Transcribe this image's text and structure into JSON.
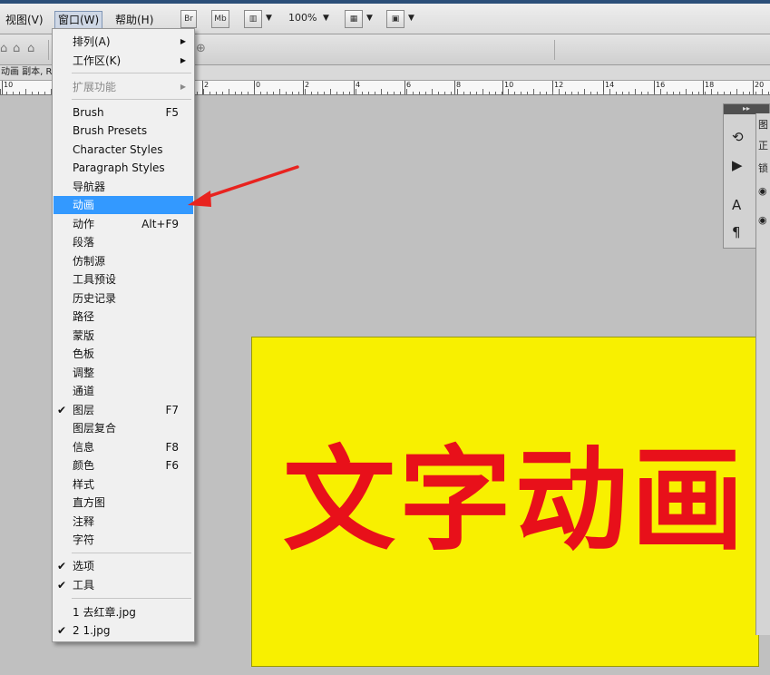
{
  "menubar": {
    "items": [
      "视图(V)",
      "窗口(W)",
      "帮助(H)"
    ],
    "br_label": "Br",
    "mb_label": "Mb",
    "zoom": "100%"
  },
  "tab": {
    "title": "动画 副本, R"
  },
  "ruler": {
    "labels": [
      "10",
      "2",
      "0",
      "2",
      "4",
      "6",
      "8",
      "10",
      "12",
      "14",
      "16",
      "18",
      "20"
    ]
  },
  "window_menu": {
    "arrange": "排列(A)",
    "workspace": "工作区(K)",
    "extensions": "扩展功能",
    "brush": "Brush",
    "brush_sc": "F5",
    "brush_presets": "Brush Presets",
    "char_styles": "Character Styles",
    "para_styles": "Paragraph Styles",
    "navigator": "导航器",
    "animation": "动画",
    "actions": "动作",
    "actions_sc": "Alt+F9",
    "paragraph": "段落",
    "clone_source": "仿制源",
    "tool_presets": "工具预设",
    "history": "历史记录",
    "paths": "路径",
    "masks": "蒙版",
    "swatches": "色板",
    "adjustments": "调整",
    "channels": "通道",
    "layers": "图层",
    "layers_sc": "F7",
    "layer_comps": "图层复合",
    "info": "信息",
    "info_sc": "F8",
    "color": "颜色",
    "color_sc": "F6",
    "styles": "样式",
    "histogram": "直方图",
    "notes": "注释",
    "character": "字符",
    "options": "选项",
    "tools": "工具",
    "file1": "1 去红章.jpg",
    "file2": "2 1.jpg"
  },
  "canvas": {
    "text": "文字动画",
    "bg_color": "#f8f000",
    "text_color": "#e8101a"
  },
  "panel": {
    "head": "▸▸",
    "r1": "图",
    "r2": "正",
    "r3": "锁"
  },
  "accent": {
    "highlight": "#3399ff",
    "arrow": "#e8231f"
  }
}
